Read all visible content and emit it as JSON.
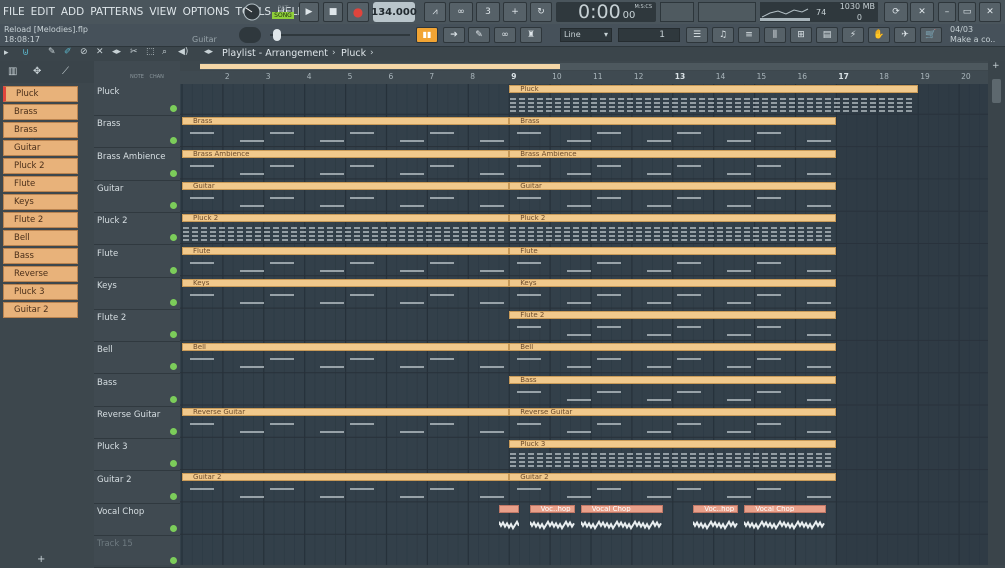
{
  "menu": [
    "FILE",
    "EDIT",
    "ADD",
    "PATTERNS",
    "VIEW",
    "OPTIONS",
    "TOOLS",
    "HELP"
  ],
  "transport": {
    "mode_pat": "PAT",
    "mode_song": "SONG",
    "tempo": "134.000",
    "time": "0:00",
    "time_sub": "00",
    "time_unit": "M:S:CS"
  },
  "monitor": {
    "cpu": "74",
    "memory": "1030 MB",
    "voices": "0"
  },
  "project": {
    "name": "Reload [Melodies].flp",
    "time": "18:08:17",
    "hint": "Guitar"
  },
  "toolbar": {
    "snap": "Line",
    "pattern_num": "1"
  },
  "hint_panel": {
    "date": "04/03",
    "text": "Make a co.."
  },
  "playlist": {
    "title": "Playlist - Arrangement",
    "breadcrumb": "Pluck",
    "ruler_labels": {
      "chan": "CHAN",
      "note": "NOTE"
    }
  },
  "channels": [
    "Pluck",
    "Brass",
    "Brass Ambience",
    "Guitar",
    "Pluck 2",
    "Flute",
    "Keys",
    "Flute 2",
    "Bell",
    "Bass",
    "Reverse Guitar",
    "Pluck 3",
    "Guitar 2"
  ],
  "tracks": [
    "Pluck",
    "Brass",
    "Brass Ambience",
    "Guitar",
    "Pluck 2",
    "Flute",
    "Keys",
    "Flute 2",
    "Bell",
    "Bass",
    "Reverse Guitar",
    "Pluck 3",
    "Guitar 2",
    "Vocal Chop",
    "Track 15"
  ],
  "ruler": [
    "2",
    "3",
    "4",
    "5",
    "6",
    "7",
    "8",
    "9",
    "10",
    "11",
    "12",
    "13",
    "14",
    "15",
    "16",
    "17",
    "18",
    "19",
    "20"
  ],
  "clips": [
    {
      "label": "Pluck",
      "track": 0,
      "start": 9,
      "end": 19
    },
    {
      "label": "Brass",
      "track": 1,
      "start": 1,
      "end": 9
    },
    {
      "label": "Brass",
      "track": 1,
      "start": 9,
      "end": 17
    },
    {
      "label": "Brass Ambience",
      "track": 2,
      "start": 1,
      "end": 9
    },
    {
      "label": "Brass Ambience",
      "track": 2,
      "start": 9,
      "end": 17
    },
    {
      "label": "Guitar",
      "track": 3,
      "start": 1,
      "end": 9
    },
    {
      "label": "Guitar",
      "track": 3,
      "start": 9,
      "end": 17
    },
    {
      "label": "Pluck 2",
      "track": 4,
      "start": 1,
      "end": 9
    },
    {
      "label": "Pluck 2",
      "track": 4,
      "start": 9,
      "end": 17
    },
    {
      "label": "Flute",
      "track": 5,
      "start": 1,
      "end": 9
    },
    {
      "label": "Flute",
      "track": 5,
      "start": 9,
      "end": 17
    },
    {
      "label": "Keys",
      "track": 6,
      "start": 1,
      "end": 9
    },
    {
      "label": "Keys",
      "track": 6,
      "start": 9,
      "end": 17
    },
    {
      "label": "Flute 2",
      "track": 7,
      "start": 9,
      "end": 17
    },
    {
      "label": "Bell",
      "track": 8,
      "start": 1,
      "end": 9
    },
    {
      "label": "Bell",
      "track": 8,
      "start": 9,
      "end": 17
    },
    {
      "label": "Bass",
      "track": 9,
      "start": 9,
      "end": 17
    },
    {
      "label": "Reverse Guitar",
      "track": 10,
      "start": 1,
      "end": 9
    },
    {
      "label": "Reverse Guitar",
      "track": 10,
      "start": 9,
      "end": 17
    },
    {
      "label": "Pluck 3",
      "track": 11,
      "start": 9,
      "end": 17
    },
    {
      "label": "Guitar 2",
      "track": 12,
      "start": 1,
      "end": 9
    },
    {
      "label": "Guitar 2",
      "track": 12,
      "start": 9,
      "end": 17
    },
    {
      "label": "",
      "track": 13,
      "start": 8.75,
      "end": 9.25,
      "audio": true
    },
    {
      "label": "Voc..hop",
      "track": 13,
      "start": 9.5,
      "end": 10.6,
      "audio": true
    },
    {
      "label": "Vocal Chop",
      "track": 13,
      "start": 10.75,
      "end": 12.75,
      "audio": true
    },
    {
      "label": "Voc..hop",
      "track": 13,
      "start": 13.5,
      "end": 14.6,
      "audio": true
    },
    {
      "label": "Vocal Chop",
      "track": 13,
      "start": 14.75,
      "end": 16.75,
      "audio": true
    }
  ]
}
